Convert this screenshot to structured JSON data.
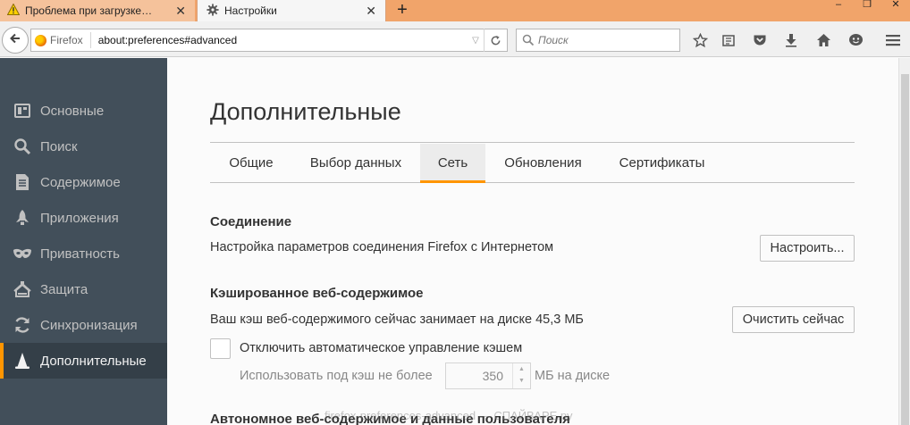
{
  "tabs": [
    {
      "title": "Проблема при загрузке страницы",
      "icon": "warning-icon",
      "active": false
    },
    {
      "title": "Настройки",
      "icon": "gear-icon",
      "active": true
    }
  ],
  "navbar": {
    "identity_label": "Firefox",
    "url": "about:preferences#advanced",
    "search_placeholder": "Поиск"
  },
  "sidebar": {
    "items": [
      {
        "label": "Основные",
        "icon": "general-icon"
      },
      {
        "label": "Поиск",
        "icon": "search-icon"
      },
      {
        "label": "Содержимое",
        "icon": "content-icon"
      },
      {
        "label": "Приложения",
        "icon": "applications-icon"
      },
      {
        "label": "Приватность",
        "icon": "privacy-mask-icon"
      },
      {
        "label": "Защита",
        "icon": "security-icon"
      },
      {
        "label": "Синхронизация",
        "icon": "sync-icon"
      },
      {
        "label": "Дополнительные",
        "icon": "advanced-icon",
        "selected": true
      }
    ]
  },
  "main": {
    "title": "Дополнительные",
    "tabs": [
      {
        "label": "Общие"
      },
      {
        "label": "Выбор данных"
      },
      {
        "label": "Сеть",
        "selected": true
      },
      {
        "label": "Обновления"
      },
      {
        "label": "Сертификаты"
      }
    ],
    "connection": {
      "heading": "Соединение",
      "description": "Настройка параметров соединения Firefox с Интернетом",
      "button": "Настроить..."
    },
    "cache": {
      "heading": "Кэшированное веб-содержимое",
      "description": "Ваш кэш веб-содержимого сейчас занимает на диске 45,3 МБ",
      "button": "Очистить сейчас",
      "override_label": "Отключить автоматическое управление кэшем",
      "override_checked": false,
      "limit_label": "Использовать под кэш не более",
      "limit_value": "350",
      "limit_unit": "МБ на диске"
    },
    "offline_heading": "Автономное веб-содержимое и данные пользователя",
    "watermark": "firefox-preferences-advanced — СПАЙВАРЕ.ру"
  },
  "colors": {
    "accent": "#ff9500",
    "sidebar_bg": "#424f5a",
    "tabstrip_bg": "#f1a46a"
  }
}
